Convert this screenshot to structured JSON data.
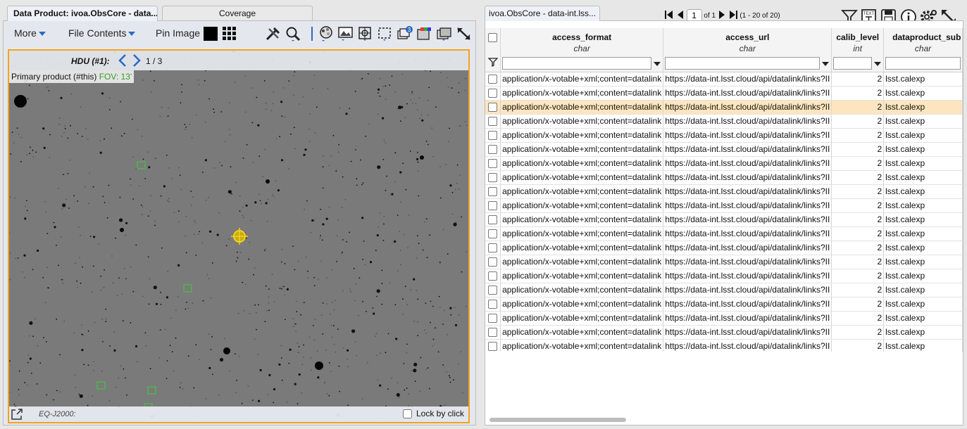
{
  "left_tabs": [
    {
      "label": "Data Product: ivoa.ObsCore - data...",
      "active": true
    },
    {
      "label": "Coverage",
      "active": false
    }
  ],
  "toolbar": {
    "more": "More",
    "file_contents": "File Contents",
    "pin_image": "Pin Image",
    "layers_badge": "3",
    "icons": [
      "tools-icon",
      "zoom-icon",
      "color-stretch-icon",
      "layers-overlay-icon",
      "crosshair-icon",
      "select-area-icon",
      "layers-icon",
      "rgb-icon",
      "image-stack-icon",
      "expand-icon"
    ]
  },
  "viewer": {
    "hdu_label": "HDU (#1):",
    "hdu_count": "1 / 3",
    "product_label": "Primary product (#this)",
    "fov": "FOV: 13'",
    "coord_system": "EQ-J2000:",
    "lock_by_click": "Lock by click"
  },
  "right_tab": {
    "label": "ivoa.ObsCore - data-int.lss..."
  },
  "pager": {
    "page": "1",
    "of": "of 1",
    "range": "(1 - 20 of 20)"
  },
  "table": {
    "columns": [
      {
        "name": "access_format",
        "type": "char"
      },
      {
        "name": "access_url",
        "type": "char"
      },
      {
        "name": "calib_level",
        "type": "int"
      },
      {
        "name": "dataproduct_sub",
        "type": "char"
      }
    ],
    "selected_row": 2,
    "rows": [
      [
        "application/x-votable+xml;content=datalink",
        "https://data-int.lsst.cloud/api/datalink/links?II",
        "2",
        "lsst.calexp"
      ],
      [
        "application/x-votable+xml;content=datalink",
        "https://data-int.lsst.cloud/api/datalink/links?II",
        "2",
        "lsst.calexp"
      ],
      [
        "application/x-votable+xml;content=datalink",
        "https://data-int.lsst.cloud/api/datalink/links?II",
        "2",
        "lsst.calexp"
      ],
      [
        "application/x-votable+xml;content=datalink",
        "https://data-int.lsst.cloud/api/datalink/links?II",
        "2",
        "lsst.calexp"
      ],
      [
        "application/x-votable+xml;content=datalink",
        "https://data-int.lsst.cloud/api/datalink/links?II",
        "2",
        "lsst.calexp"
      ],
      [
        "application/x-votable+xml;content=datalink",
        "https://data-int.lsst.cloud/api/datalink/links?II",
        "2",
        "lsst.calexp"
      ],
      [
        "application/x-votable+xml;content=datalink",
        "https://data-int.lsst.cloud/api/datalink/links?II",
        "2",
        "lsst.calexp"
      ],
      [
        "application/x-votable+xml;content=datalink",
        "https://data-int.lsst.cloud/api/datalink/links?II",
        "2",
        "lsst.calexp"
      ],
      [
        "application/x-votable+xml;content=datalink",
        "https://data-int.lsst.cloud/api/datalink/links?II",
        "2",
        "lsst.calexp"
      ],
      [
        "application/x-votable+xml;content=datalink",
        "https://data-int.lsst.cloud/api/datalink/links?II",
        "2",
        "lsst.calexp"
      ],
      [
        "application/x-votable+xml;content=datalink",
        "https://data-int.lsst.cloud/api/datalink/links?II",
        "2",
        "lsst.calexp"
      ],
      [
        "application/x-votable+xml;content=datalink",
        "https://data-int.lsst.cloud/api/datalink/links?II",
        "2",
        "lsst.calexp"
      ],
      [
        "application/x-votable+xml;content=datalink",
        "https://data-int.lsst.cloud/api/datalink/links?II",
        "2",
        "lsst.calexp"
      ],
      [
        "application/x-votable+xml;content=datalink",
        "https://data-int.lsst.cloud/api/datalink/links?II",
        "2",
        "lsst.calexp"
      ],
      [
        "application/x-votable+xml;content=datalink",
        "https://data-int.lsst.cloud/api/datalink/links?II",
        "2",
        "lsst.calexp"
      ],
      [
        "application/x-votable+xml;content=datalink",
        "https://data-int.lsst.cloud/api/datalink/links?II",
        "2",
        "lsst.calexp"
      ],
      [
        "application/x-votable+xml;content=datalink",
        "https://data-int.lsst.cloud/api/datalink/links?II",
        "2",
        "lsst.calexp"
      ],
      [
        "application/x-votable+xml;content=datalink",
        "https://data-int.lsst.cloud/api/datalink/links?II",
        "2",
        "lsst.calexp"
      ],
      [
        "application/x-votable+xml;content=datalink",
        "https://data-int.lsst.cloud/api/datalink/links?II",
        "2",
        "lsst.calexp"
      ],
      [
        "application/x-votable+xml;content=datalink",
        "https://data-int.lsst.cloud/api/datalink/links?II",
        "2",
        "lsst.calexp"
      ]
    ]
  },
  "colors": {
    "viewer_border": "#f3a21e",
    "selected_row": "#fde6bf",
    "accent": "#2a68c0",
    "overlay_green": "#2f9d2f",
    "target_yellow": "#f2d21b"
  }
}
